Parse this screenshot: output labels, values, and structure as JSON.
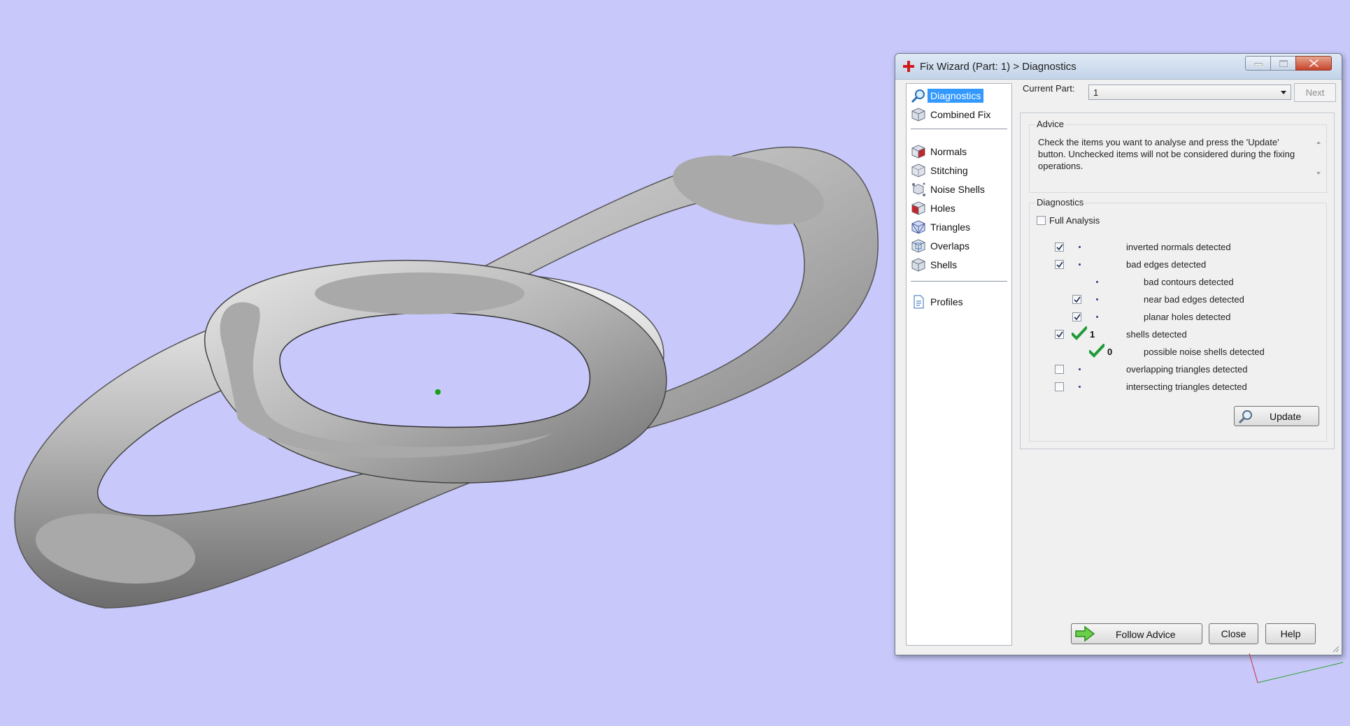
{
  "window": {
    "title": "Fix Wizard (Part: 1) > Diagnostics",
    "app_icon": "red-cross-icon"
  },
  "nav": {
    "items": [
      {
        "label": "Diagnostics",
        "icon": "magnifier-icon",
        "selected": true
      },
      {
        "label": "Combined Fix",
        "icon": "cube-icon"
      },
      {
        "label": "Normals",
        "icon": "normals-cube-icon"
      },
      {
        "label": "Stitching",
        "icon": "stitching-cube-icon"
      },
      {
        "label": "Noise Shells",
        "icon": "noise-shells-icon"
      },
      {
        "label": "Holes",
        "icon": "holes-cube-icon"
      },
      {
        "label": "Triangles",
        "icon": "triangles-cube-icon"
      },
      {
        "label": "Overlaps",
        "icon": "overlaps-cube-icon"
      },
      {
        "label": "Shells",
        "icon": "shells-cube-icon"
      },
      {
        "label": "Profiles",
        "icon": "document-icon"
      }
    ]
  },
  "current_part": {
    "label": "Current Part:",
    "value": "1",
    "next_label": "Next"
  },
  "advice": {
    "title": "Advice",
    "text": "Check the items you want to analyse and press the 'Update' button. Unchecked items will not be considered during the fixing operations."
  },
  "diagnostics": {
    "title": "Diagnostics",
    "full_analysis": {
      "label": "Full Analysis",
      "checked": false
    },
    "rows": [
      {
        "label": "inverted normals detected",
        "checked": true,
        "count": ""
      },
      {
        "label": "bad edges detected",
        "checked": true,
        "count": ""
      },
      {
        "label": "bad contours detected",
        "count": ""
      },
      {
        "label": "near bad edges detected",
        "checked": true,
        "count": ""
      },
      {
        "label": "planar holes detected",
        "checked": true,
        "count": ""
      },
      {
        "label": "shells detected",
        "checked": true,
        "count": "1",
        "ok": true
      },
      {
        "label": "possible noise shells detected",
        "count": "0",
        "ok": true
      },
      {
        "label": "overlapping triangles detected",
        "checked": false,
        "count": ""
      },
      {
        "label": "intersecting triangles detected",
        "checked": false,
        "count": ""
      }
    ],
    "update_label": "Update"
  },
  "buttons": {
    "follow_advice": "Follow Advice",
    "close": "Close",
    "help": "Help"
  },
  "colors": {
    "viewport_bg": "#c8c8fa",
    "selection": "#3399ff",
    "ok_tick": "#1f9a3a"
  }
}
